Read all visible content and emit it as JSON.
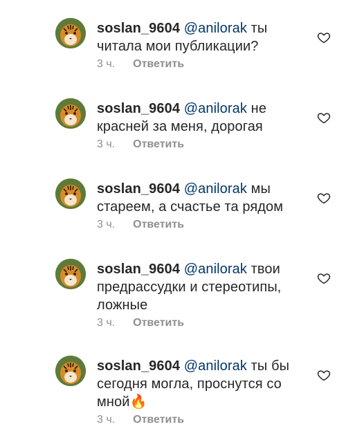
{
  "comments": [
    {
      "username": "soslan_9604",
      "mention": "@anilorak",
      "text": "ты читала мои публикации?",
      "emoji": "",
      "time": "3 ч.",
      "reply_label": "Ответить"
    },
    {
      "username": "soslan_9604",
      "mention": "@anilorak",
      "text": "не красней за меня, дорогая",
      "emoji": "",
      "time": "3 ч.",
      "reply_label": "Ответить"
    },
    {
      "username": "soslan_9604",
      "mention": "@anilorak",
      "text": "мы стареем, а счастье та рядом",
      "emoji": "",
      "time": "3 ч.",
      "reply_label": "Ответить"
    },
    {
      "username": "soslan_9604",
      "mention": "@anilorak",
      "text": "твои предрассудки и стереотипы, ложные",
      "emoji": "",
      "time": "3 ч.",
      "reply_label": "Ответить"
    },
    {
      "username": "soslan_9604",
      "mention": "@anilorak",
      "text": "ты бы сегодня могла, проснутся со мной",
      "emoji": "🔥",
      "time": "3 ч.",
      "reply_label": "Ответить"
    }
  ],
  "icons": {
    "avatar": "tiger-avatar-icon",
    "like": "heart-outline-icon"
  },
  "colors": {
    "text": "#262626",
    "mention": "#00376b",
    "meta": "#8e8e8e"
  }
}
